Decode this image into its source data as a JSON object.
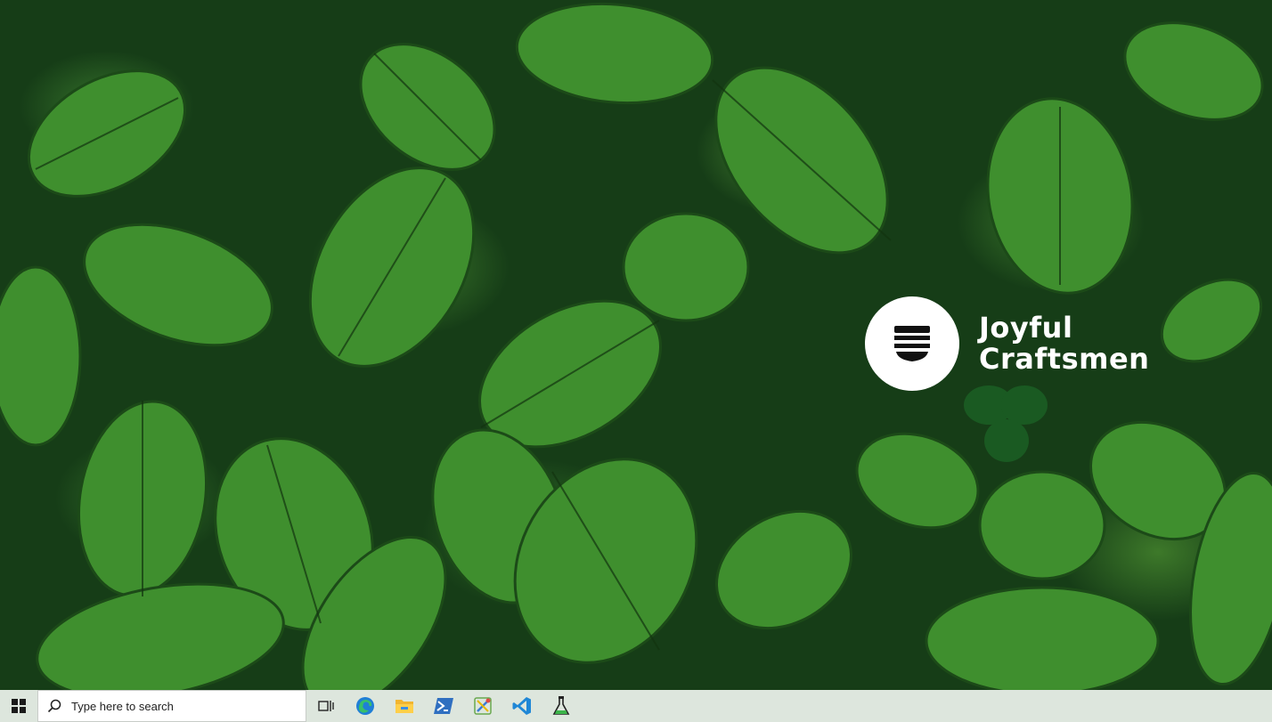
{
  "wallpaper": {
    "subject": "green-leaf-foliage"
  },
  "logo": {
    "line1": "Joyful",
    "line2": "Craftsmen"
  },
  "taskbar": {
    "search_placeholder": "Type here to search",
    "icons": [
      "windows-start-icon",
      "task-view-icon",
      "edge-icon",
      "file-explorer-icon",
      "powershell-icon",
      "tool-app-icon",
      "vscode-icon",
      "flask-app-icon"
    ]
  }
}
